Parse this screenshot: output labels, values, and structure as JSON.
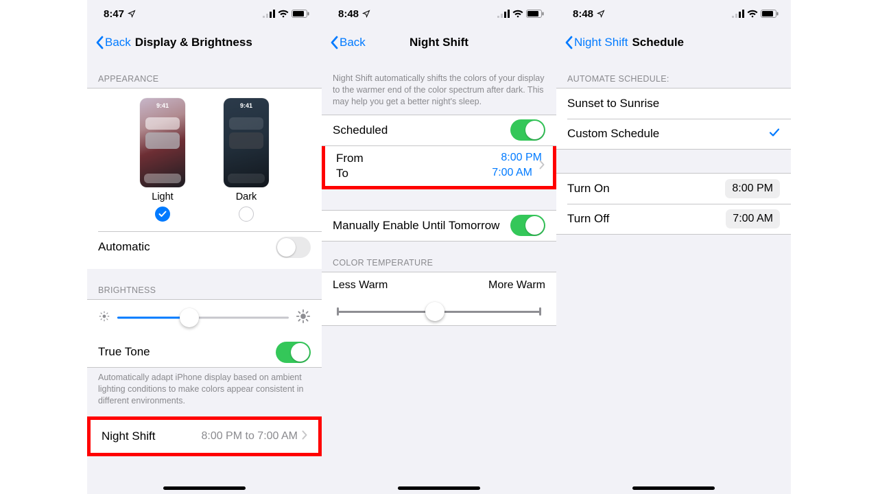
{
  "status": {
    "time_a": "8:47",
    "time_b": "8:48",
    "time_c": "8:48"
  },
  "screen1": {
    "back": "Back",
    "title": "Display & Brightness",
    "appearance_header": "APPEARANCE",
    "preview_clock": "9:41",
    "light_label": "Light",
    "dark_label": "Dark",
    "automatic_label": "Automatic",
    "brightness_header": "BRIGHTNESS",
    "brightness_value_pct": 42,
    "truetone_label": "True Tone",
    "truetone_explain": "Automatically adapt iPhone display based on ambient lighting conditions to make colors appear consistent in different environments.",
    "nightshift_label": "Night Shift",
    "nightshift_detail": "8:00 PM to 7:00 AM"
  },
  "screen2": {
    "back": "Back",
    "title": "Night Shift",
    "intro": "Night Shift automatically shifts the colors of your display to the warmer end of the color spectrum after dark. This may help you get a better night's sleep.",
    "scheduled_label": "Scheduled",
    "from_label": "From",
    "from_value": "8:00 PM",
    "to_label": "To",
    "to_value": "7:00 AM",
    "manual_label": "Manually Enable Until Tomorrow",
    "color_temp_header": "COLOR TEMPERATURE",
    "less_warm": "Less Warm",
    "more_warm": "More Warm",
    "temp_value_pct": 48
  },
  "screen3": {
    "back": "Night Shift",
    "title": "Schedule",
    "automate_header": "AUTOMATE SCHEDULE:",
    "opt_sunset": "Sunset to Sunrise",
    "opt_custom": "Custom Schedule",
    "turn_on_label": "Turn On",
    "turn_on_value": "8:00 PM",
    "turn_off_label": "Turn Off",
    "turn_off_value": "7:00 AM"
  }
}
